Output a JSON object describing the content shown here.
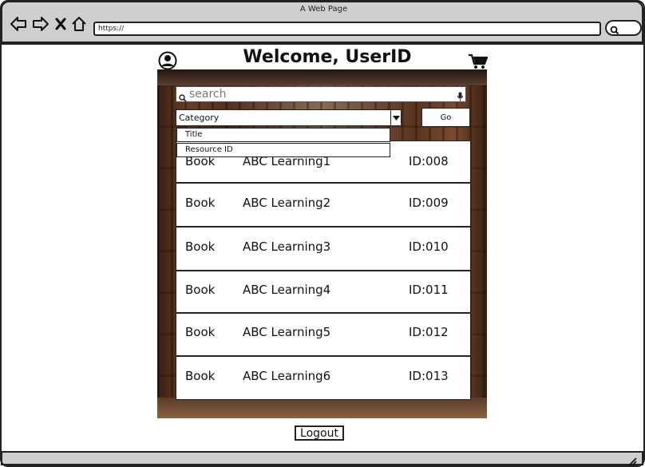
{
  "browser": {
    "title": "A Web Page",
    "url": "https://"
  },
  "header": {
    "welcome": "Welcome, UserID"
  },
  "search": {
    "placeholder": "search"
  },
  "filter": {
    "category_label": "Category",
    "go_label": "Go",
    "options": [
      "Title",
      "Resource ID"
    ]
  },
  "results": [
    {
      "type": "Book",
      "title": "ABC Learning1",
      "id": "ID:008"
    },
    {
      "type": "Book",
      "title": "ABC Learning2",
      "id": "ID:009"
    },
    {
      "type": "Book",
      "title": "ABC Learning3",
      "id": "ID:010"
    },
    {
      "type": "Book",
      "title": "ABC Learning4",
      "id": "ID:011"
    },
    {
      "type": "Book",
      "title": "ABC Learning5",
      "id": "ID:012"
    },
    {
      "type": "Book",
      "title": "ABC Learning6",
      "id": "ID:013"
    }
  ],
  "footer": {
    "logout_label": "Logout"
  },
  "icons": {
    "back": "back-arrow-icon",
    "forward": "forward-arrow-icon",
    "stop": "close-icon",
    "home": "home-icon",
    "search": "search-icon",
    "mic": "microphone-icon",
    "profile": "user-profile-icon",
    "cart": "shopping-cart-icon",
    "dropdown": "dropdown-arrow-icon",
    "resize": "resize-grip-icon"
  }
}
